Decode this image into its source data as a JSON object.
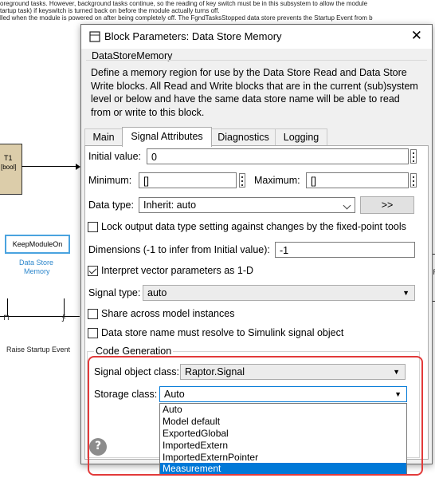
{
  "background": {
    "text_lines": [
      "oreground tasks. However, background tasks continue, so the reading of key switch must be in this subsystem to allow the module",
      "tartup task) if keyswitch is turned back on before the module actually turns off.",
      "lled when the module is powered on after being completely off. The FgndTasksStopped data store prevents the Startup Event from b"
    ],
    "left_block_label_1": "T1",
    "left_block_label_2": "[bool]",
    "keymodule_label": "KeepModuleOn",
    "data_store_label_1": "Data Store",
    "data_store_label_2": "Memory",
    "raise_event_label": "Raise Startup Event",
    "pulse_symbol": "⊓",
    "edge_symbol": "∱",
    "right_cut_text": "IR"
  },
  "dialog": {
    "title": "Block Parameters: Data Store Memory",
    "close_icon": "close-icon",
    "block_type": "DataStoreMemory",
    "description": "Define a memory region for use by the Data Store Read and Data Store Write blocks. All Read and Write blocks that are in the current (sub)system level or below and have the same data store name will be able to read from or write to this block.",
    "tabs": [
      {
        "label": "Main",
        "active": false
      },
      {
        "label": "Signal Attributes",
        "active": true
      },
      {
        "label": "Diagnostics",
        "active": false
      },
      {
        "label": "Logging",
        "active": false
      }
    ],
    "initial_value_label": "Initial value:",
    "initial_value": "0",
    "minimum_label": "Minimum:",
    "minimum_value": "[]",
    "maximum_label": "Maximum:",
    "maximum_value": "[]",
    "data_type_label": "Data type:",
    "data_type_value": "Inherit: auto",
    "data_type_assistant_button": ">>",
    "lock_checkbox_label": "Lock output data type setting against changes by the fixed-point tools",
    "lock_checked": false,
    "dimensions_label": "Dimensions (-1 to infer from Initial value):",
    "dimensions_value": "-1",
    "interpret_checkbox_label": "Interpret vector parameters as 1-D",
    "interpret_checked": true,
    "signal_type_label": "Signal type:",
    "signal_type_value": "auto",
    "share_checkbox_label": "Share across model instances",
    "share_checked": false,
    "resolve_checkbox_label": "Data store name must resolve to Simulink signal object",
    "resolve_checked": false,
    "code_generation_title": "Code Generation",
    "signal_object_class_label": "Signal object class:",
    "signal_object_class_value": "Raptor.Signal",
    "storage_class_label": "Storage class:",
    "storage_class_value": "Auto",
    "storage_class_options": [
      "Auto",
      "Model default",
      "ExportedGlobal",
      "ImportedExtern",
      "ImportedExternPointer",
      "Measurement"
    ],
    "storage_class_highlighted": "Measurement",
    "help_icon": "help-icon",
    "highlight_color": "#e23a3a",
    "selection_color": "#0078d7"
  }
}
